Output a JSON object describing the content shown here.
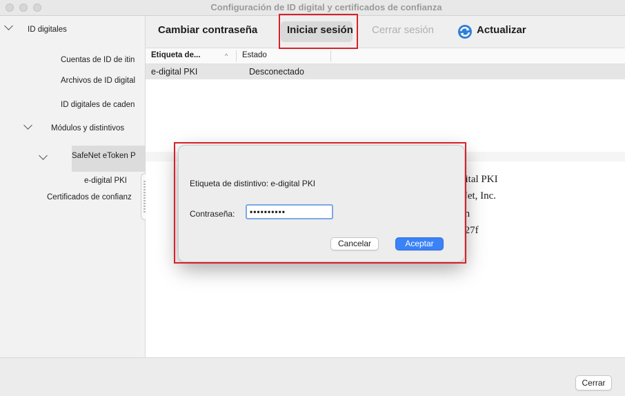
{
  "window": {
    "title": "Configuración de ID digital y certificados de confianza"
  },
  "sidebar": {
    "items": [
      {
        "label": "ID digitales",
        "expanded": true
      },
      {
        "label": "Cuentas de ID de itin"
      },
      {
        "label": "Archivos de ID digital"
      },
      {
        "label": "ID digitales de caden"
      },
      {
        "label": "Módulos y distintivos",
        "expanded": true
      },
      {
        "label": "SafeNet eToken P",
        "expanded": true
      },
      {
        "label": "e-digital PKI"
      },
      {
        "label": "Certificados de confianz"
      }
    ]
  },
  "toolbar": {
    "change_password": "Cambiar contraseña",
    "login": "Iniciar sesión",
    "logout": "Cerrar sesión",
    "refresh": "Actualizar"
  },
  "table": {
    "columns": [
      "Etiqueta de...",
      "Estado"
    ],
    "rows": [
      {
        "label": "e-digital PKI",
        "status": "Desconectado"
      }
    ]
  },
  "details": [
    "gital PKI",
    "Net, Inc.",
    "en",
    "a27f"
  ],
  "dialog": {
    "label_text": "Etiqueta de distintivo: e-digital PKI",
    "password_label": "Contraseña:",
    "password_value": "••••••••••",
    "cancel": "Cancelar",
    "accept": "Aceptar"
  },
  "footer": {
    "close": "Cerrar"
  },
  "colors": {
    "highlight": "#d81f2a",
    "accent": "#3a82f6"
  }
}
